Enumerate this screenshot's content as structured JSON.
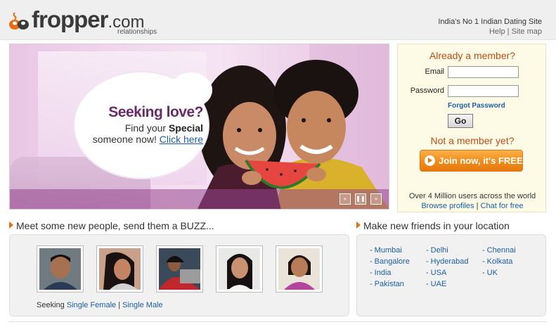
{
  "header": {
    "logo_text": "fropper",
    "logo_domain": ".com",
    "logo_sub": "relationships",
    "tagline": "India's No 1 Indian Dating Site",
    "links": [
      "Help",
      "Site map"
    ],
    "link_sep": "|"
  },
  "banner": {
    "line1": "Seeking love?",
    "line2_pre": "Find your ",
    "line2_bold": "Special",
    "line3_pre": "someone now! ",
    "line3_link": "Click here",
    "controls": [
      "prev",
      "pause",
      "next"
    ],
    "control_glyphs": [
      "«",
      "❚❚",
      "»"
    ]
  },
  "login": {
    "title": "Already a member?",
    "email_label": "Email",
    "email_value": "",
    "password_label": "Password",
    "password_value": "",
    "forgot": "Forgot Password",
    "go": "Go",
    "not_member": "Not a member yet?",
    "join": "Join now, it's FREE",
    "users_text": "Over 4 Million users across the world",
    "browse": "Browse profiles",
    "chat": "Chat for free",
    "sep": "|"
  },
  "meet": {
    "heading": "Meet some new people, send them a BUZZ...",
    "profiles": [
      "profile-1",
      "profile-2",
      "profile-3",
      "profile-4",
      "profile-5"
    ],
    "seeking_label": "Seeking",
    "single_female": "Single Female",
    "single_male": "Single Male",
    "sep": "|"
  },
  "location": {
    "heading": "Make new friends in your location",
    "col1": [
      "Mumbai",
      "Bangalore",
      "India",
      "Pakistan"
    ],
    "col2": [
      "Delhi",
      "Hyderabad",
      "USA",
      "UAE"
    ],
    "col3": [
      "Chennai",
      "Kolkata",
      "UK"
    ]
  },
  "colors": {
    "accent_orange": "#e96d10",
    "link_blue": "#1a5fa8",
    "heading_red": "#c24c15"
  }
}
